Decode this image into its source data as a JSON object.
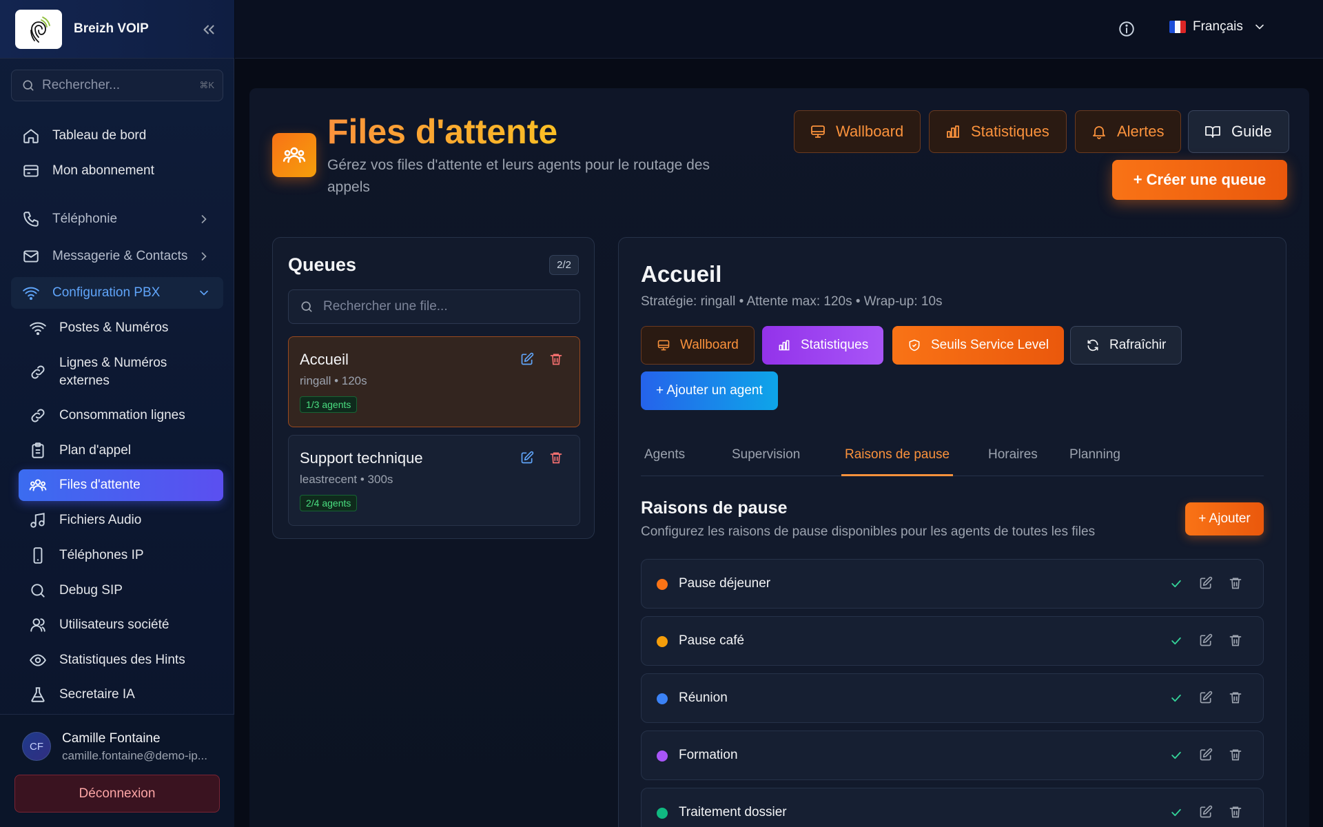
{
  "sidebar": {
    "brand_name": "Breizh VOIP",
    "search_placeholder": "Rechercher...",
    "search_shortcut": "⌘K",
    "items": {
      "dashboard": "Tableau de bord",
      "subscription": "Mon abonnement",
      "telephony": "Téléphonie",
      "messaging": "Messagerie & Contacts",
      "pbx_config": "Configuration PBX"
    },
    "sub_items": {
      "extensions": "Postes & Numéros",
      "external_lines_1": "Lignes & Numéros",
      "external_lines_2": "externes",
      "line_usage": "Consommation lignes",
      "dial_plan": "Plan d'appel",
      "queues": "Files d'attente",
      "audio_files": "Fichiers Audio",
      "ip_phones": "Téléphones IP",
      "debug_sip": "Debug SIP",
      "company_users": "Utilisateurs société",
      "hints_stats": "Statistiques des Hints",
      "ai_secretary": "Secretaire IA"
    },
    "user": {
      "initials": "CF",
      "name": "Camille Fontaine",
      "email": "camille.fontaine@demo-ip..."
    },
    "logout_label": "Déconnexion"
  },
  "topbar": {
    "language": "Français"
  },
  "page": {
    "title": "Files d'attente",
    "subtitle": "Gérez vos files d'attente et leurs agents pour le routage des appels",
    "buttons": {
      "wallboard": "Wallboard",
      "statistics": "Statistiques",
      "alerts": "Alertes",
      "guide": "Guide",
      "create_queue": "+ Créer une queue"
    }
  },
  "queues_panel": {
    "title": "Queues",
    "count": "2/2",
    "search_placeholder": "Rechercher une file...",
    "queues": [
      {
        "name": "Accueil",
        "meta": "ringall • 120s",
        "agents": "1/3 agents"
      },
      {
        "name": "Support technique",
        "meta": "leastrecent • 300s",
        "agents": "2/4 agents"
      }
    ]
  },
  "detail": {
    "title": "Accueil",
    "meta": "Stratégie: ringall • Attente max: 120s • Wrap-up: 10s",
    "buttons": {
      "wallboard": "Wallboard",
      "statistics": "Statistiques",
      "service_level": "Seuils Service Level",
      "refresh": "Rafraîchir",
      "add_agent": "+ Ajouter un agent"
    },
    "tabs": [
      "Agents",
      "Supervision",
      "Raisons de pause",
      "Horaires",
      "Planning"
    ],
    "active_tab": "Raisons de pause",
    "section_title": "Raisons de pause",
    "section_desc": "Configurez les raisons de pause disponibles pour les agents de toutes les files",
    "add_label": "+ Ajouter",
    "pause_reasons": [
      {
        "name": "Pause déjeuner",
        "color": "#f97316"
      },
      {
        "name": "Pause café",
        "color": "#f59e0b"
      },
      {
        "name": "Réunion",
        "color": "#3b82f6"
      },
      {
        "name": "Formation",
        "color": "#a855f7"
      },
      {
        "name": "Traitement dossier",
        "color": "#10b981"
      }
    ]
  },
  "colors": {
    "accent_orange": "#f97316",
    "active_nav": "#4f5ef0",
    "danger": "#f87171",
    "success": "#4ade80"
  }
}
